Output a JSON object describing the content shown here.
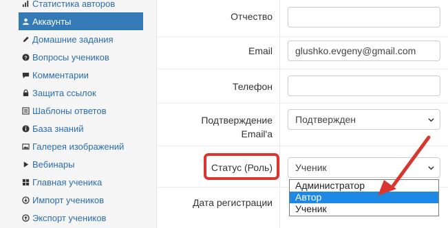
{
  "sidebar": {
    "items": [
      {
        "label": "Статистика авторов",
        "icon": "bar-chart-icon"
      },
      {
        "label": "Аккаунты",
        "icon": "user-icon",
        "active": true
      },
      {
        "label": "Домашние задания",
        "icon": "pencil-icon"
      },
      {
        "label": "Вопросы учеников",
        "icon": "question-circle-icon"
      },
      {
        "label": "Комментарии",
        "icon": "comment-icon"
      },
      {
        "label": "Защита ссылок",
        "icon": "lock-icon"
      },
      {
        "label": "Шаблоны ответов",
        "icon": "list-icon"
      },
      {
        "label": "База знаний",
        "icon": "info-circle-icon"
      },
      {
        "label": "Галерея изображений",
        "icon": "picture-icon"
      },
      {
        "label": "Вебинары",
        "icon": "play-icon"
      },
      {
        "label": "Главная ученика",
        "icon": "grid-icon"
      },
      {
        "label": "Импорт учеников",
        "icon": "import-icon"
      },
      {
        "label": "Экспорт учеников",
        "icon": "export-icon"
      }
    ]
  },
  "form": {
    "patronymic": {
      "label": "Отчество",
      "value": ""
    },
    "email": {
      "label": "Email",
      "value": "glushko.evgeny@gmail.com"
    },
    "phone": {
      "label": "Телефон",
      "value": ""
    },
    "email_confirm": {
      "label_line1": "Подтверждение",
      "label_line2": "Email'a",
      "value": "Подтвержден"
    },
    "status": {
      "label": "Статус (Роль)",
      "value": "Ученик",
      "options": [
        "Администратор",
        "Автор",
        "Ученик"
      ],
      "highlighted_option": "Автор"
    },
    "reg_date": {
      "label": "Дата регистрации"
    }
  },
  "colors": {
    "accent": "#337ab7",
    "link": "#2a6db0",
    "annotation_red": "#d9362f",
    "dropdown_highlight": "#1e88e5"
  }
}
